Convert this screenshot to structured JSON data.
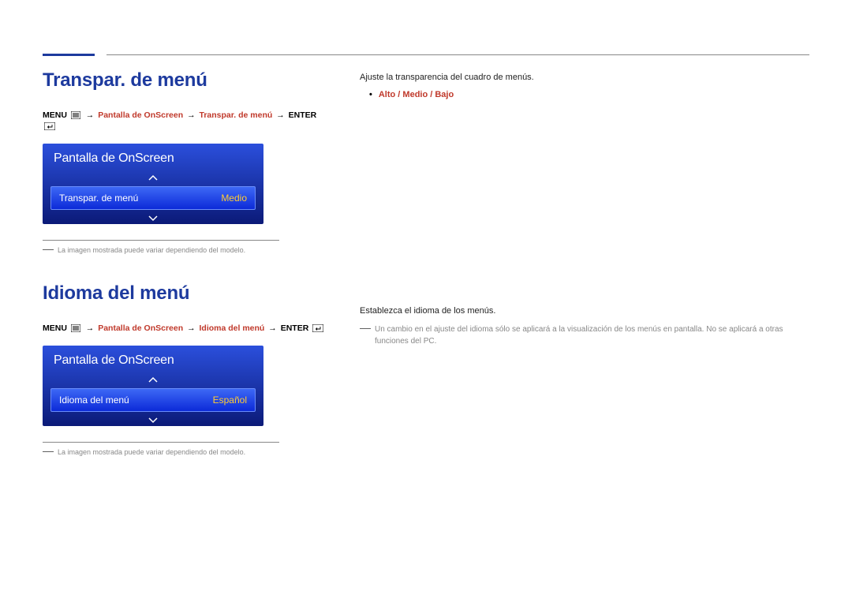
{
  "section1": {
    "title": "Transpar. de menú",
    "breadcrumb": {
      "menu_label": "MENU",
      "path1": "Pantalla de OnScreen",
      "path2": "Transpar. de menú",
      "enter_label": "ENTER"
    },
    "osd": {
      "header": "Pantalla de OnScreen",
      "item_label": "Transpar. de menú",
      "item_value": "Medio"
    },
    "note": "La imagen mostrada puede variar dependiendo del modelo.",
    "right": {
      "desc": "Ajuste la transparencia del cuadro de menús.",
      "options": "Alto / Medio / Bajo"
    }
  },
  "section2": {
    "title": "Idioma del menú",
    "breadcrumb": {
      "menu_label": "MENU",
      "path1": "Pantalla de OnScreen",
      "path2": "Idioma del menú",
      "enter_label": "ENTER"
    },
    "osd": {
      "header": "Pantalla de OnScreen",
      "item_label": "Idioma del menú",
      "item_value": "Español"
    },
    "note": "La imagen mostrada puede variar dependiendo del modelo.",
    "right": {
      "desc": "Establezca el idioma de los menús.",
      "note": "Un cambio en el ajuste del idioma sólo se aplicará a la visualización de los menús en pantalla. No se aplicará a otras funciones del PC."
    }
  }
}
